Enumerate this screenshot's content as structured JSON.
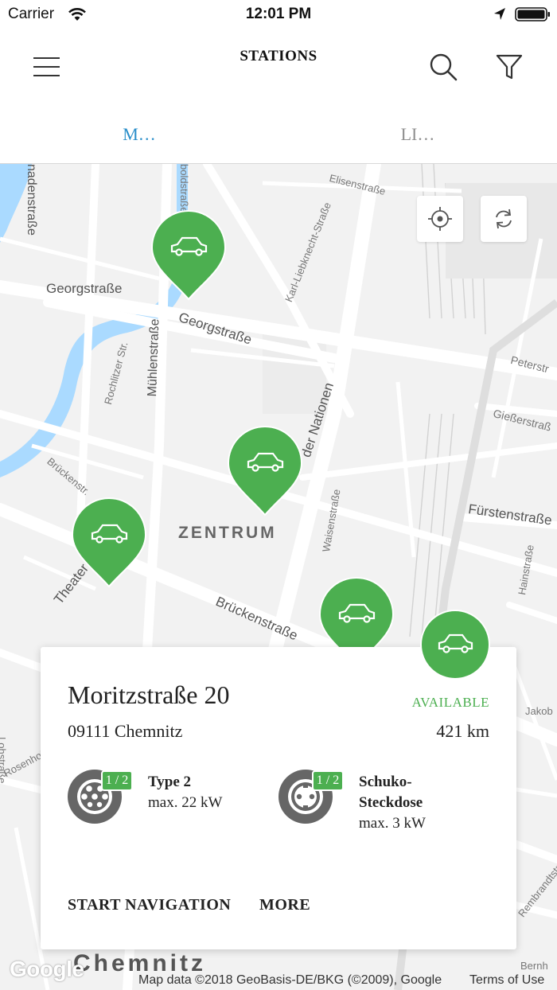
{
  "status_bar": {
    "carrier": "Carrier",
    "time": "12:01 PM",
    "icons": [
      "wifi-icon",
      "location-arrow-icon",
      "battery-icon"
    ]
  },
  "navbar": {
    "title": "STATIONS",
    "icons": [
      "menu-icon",
      "search-icon",
      "filter-icon"
    ]
  },
  "tabs": [
    {
      "label": "M…",
      "active": true
    },
    {
      "label": "LI…",
      "active": false
    }
  ],
  "map": {
    "labels": {
      "georgstrasse_1": "Georgstraße",
      "georgstrasse_2": "Georgstraße",
      "elisenstrasse": "Elisenstraße",
      "karl": "Karl-Liebknecht-Straße",
      "muehlen": "Mühlenstraße",
      "rochlitzer": "Rochlitzer Str.",
      "nationen": "der Nationen",
      "petersstr": "Peterstr",
      "giesser": "Gießerstraß",
      "fuersten": "Fürstenstraße",
      "hainstr": "Hainstraße",
      "zentrum": "ZENTRUM",
      "brueckenstr_1": "Brückenstr.",
      "brueckenstr_2": "Brückenstraße",
      "waisen": "Waisenstraße",
      "theater": "Theater",
      "nadenstr": "nadenstraße",
      "boldstr": "boldstraße",
      "lohstrasse": "Lohstraße",
      "rosenhof": "Rosenhof",
      "jakob": "Jakob",
      "rembrandt": "Rembrandtstraße",
      "bernh": "Bernh",
      "chemnitz": "Chemnitz"
    },
    "controls": [
      "target-icon",
      "refresh-icon"
    ],
    "attribution": "Map data ©2018 GeoBasis-DE/BKG (©2009), Google",
    "terms": "Terms of Use",
    "google_logo": "Google",
    "pin_color": "#4caf50"
  },
  "station": {
    "name": "Moritzstraße 20",
    "status": "AVAILABLE",
    "city": "09111 Chemnitz",
    "distance": "421 km",
    "plugs": [
      {
        "availability": "1 / 2",
        "name": "Type 2",
        "power": "max. 22 kW",
        "icon": "type2-plug-icon"
      },
      {
        "availability": "1 / 2",
        "name": "Schuko-Steckdose",
        "name_line1": "Schuko-",
        "name_line2": "Steckdose",
        "power": "max. 3 kW",
        "icon": "schuko-plug-icon"
      }
    ],
    "actions": {
      "navigate": "START NAVIGATION",
      "more": "MORE"
    }
  }
}
